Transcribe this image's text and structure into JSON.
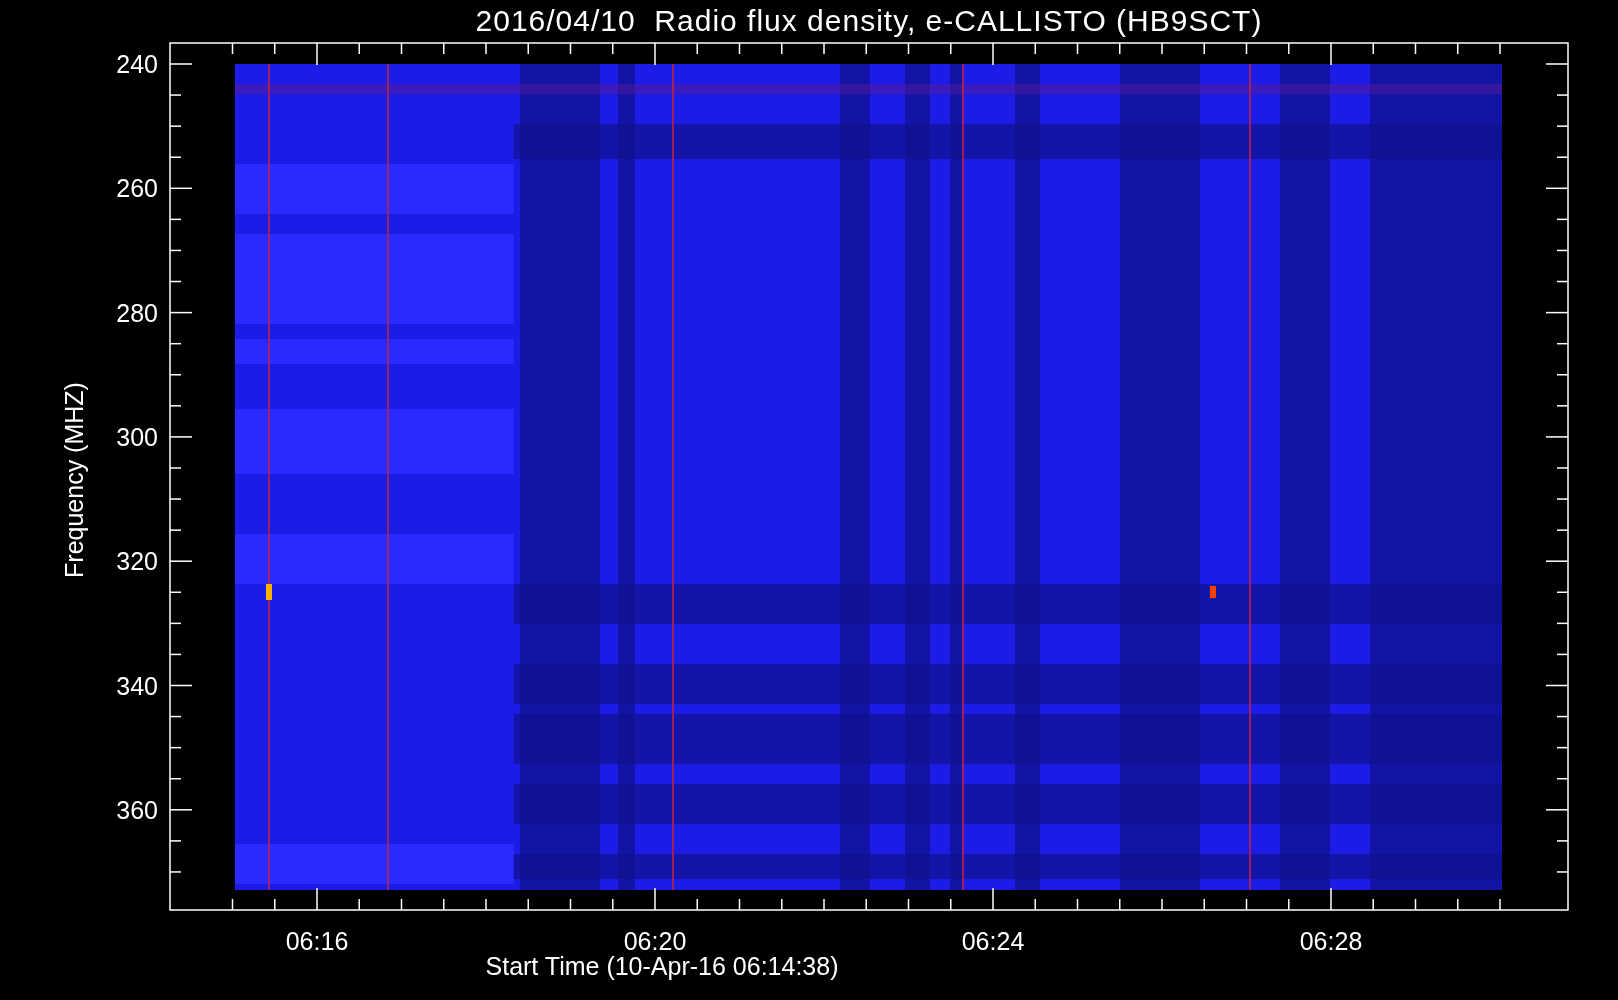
{
  "title": "2016/04/10  Radio flux density, e-CALLISTO (HB9SCT)",
  "y_axis": {
    "label": "Frequency (MHZ)",
    "ticks": [
      "240",
      "260",
      "280",
      "300",
      "320",
      "340",
      "360"
    ]
  },
  "x_axis": {
    "label": "Start Time (10-Apr-16 06:14:38)",
    "ticks": [
      "06:16",
      "06:20",
      "06:24",
      "06:28"
    ]
  }
}
